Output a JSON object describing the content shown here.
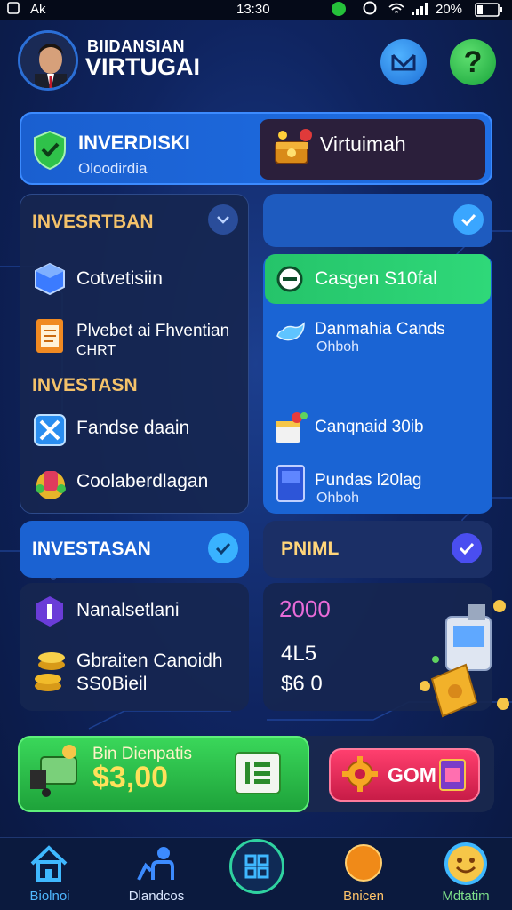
{
  "status_bar": {
    "carrier": "Ak",
    "time": "13:30",
    "battery": "20%"
  },
  "header": {
    "subtitle": "BIIDANSIAN",
    "title": "VIRTUGAI"
  },
  "top_card": {
    "title": "INVERDISKI",
    "subtitle": "Oloodirdia",
    "virtual_label": "Virtuimah"
  },
  "left_panel": {
    "section1_title": "INVESRTBAN",
    "items1": [
      {
        "label": "Cotvetisiin"
      },
      {
        "label": "Plvebet ai Fhventian",
        "sub": "CHRT"
      }
    ],
    "section2_title": "INVESTASN",
    "items2": [
      {
        "label": "Fandse daain"
      },
      {
        "label": "Coolaberdlagan"
      }
    ]
  },
  "right_panel": {
    "green_label": "Casgen S10fal",
    "items": [
      {
        "label": "Danmahia Cands",
        "sub": "Ohboh"
      },
      {
        "label": "Canqnaid 30ib"
      },
      {
        "label": "Pundas l20lag",
        "sub": "Ohboh"
      }
    ]
  },
  "section_lower": {
    "left_title": "INVESTASAN",
    "right_title": "PNIML",
    "left_items": [
      {
        "label": "Nanalsetlani"
      },
      {
        "label": "Gbraiten Canoidh",
        "sub": "SS0Bieil"
      }
    ],
    "right_values": {
      "highlight": "2000",
      "line1": "4L5",
      "line2": "$6 0"
    }
  },
  "bottom_actions": {
    "green_sub": "Bin Dienpatis",
    "green_amount": "$3,00",
    "pink_label": "GOM"
  },
  "nav": {
    "items": [
      {
        "label": "Biolnoi"
      },
      {
        "label": "Dlandcos"
      },
      {
        "label": ""
      },
      {
        "label": "Bnicen"
      },
      {
        "label": "Mdtatim"
      }
    ]
  },
  "colors": {
    "accent_blue": "#1f6fe4",
    "green": "#2fd879",
    "pink": "#ff3f6e",
    "gold": "#f4c26a"
  }
}
